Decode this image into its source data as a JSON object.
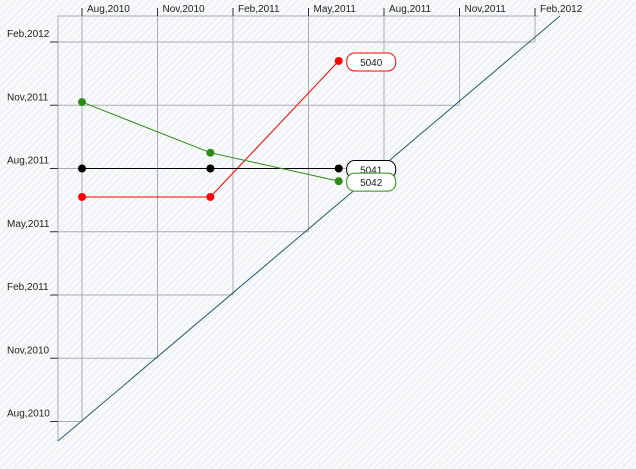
{
  "chart_data": {
    "type": "line",
    "chart_style": "milestone-trend-triangle",
    "x_axis": {
      "position": "top",
      "ticks": [
        "Aug,2010",
        "Nov,2010",
        "Feb,2011",
        "May,2011",
        "Aug,2011",
        "Nov,2011",
        "Feb,2012"
      ]
    },
    "y_axis": {
      "position": "left",
      "ticks": [
        "Aug,2010",
        "Nov,2010",
        "Feb,2011",
        "May,2011",
        "Aug,2011",
        "Nov,2011",
        "Feb,2012"
      ]
    },
    "grid": true,
    "diagonal": true,
    "series": [
      {
        "name": "5040",
        "color": "#ff0000",
        "points": [
          [
            0,
            3.55
          ],
          [
            1.7,
            3.55
          ],
          [
            3.4,
            5.7
          ]
        ]
      },
      {
        "name": "5041",
        "color": "#000000",
        "points": [
          [
            0,
            4.0
          ],
          [
            1.7,
            4.0
          ],
          [
            3.4,
            4.0
          ]
        ]
      },
      {
        "name": "5042",
        "color": "#2e8b16",
        "points": [
          [
            0,
            5.05
          ],
          [
            1.7,
            4.25
          ],
          [
            3.4,
            3.8
          ]
        ]
      }
    ],
    "diagonal_color": "#2d5a6e",
    "grid_color": "#a9adb1"
  }
}
